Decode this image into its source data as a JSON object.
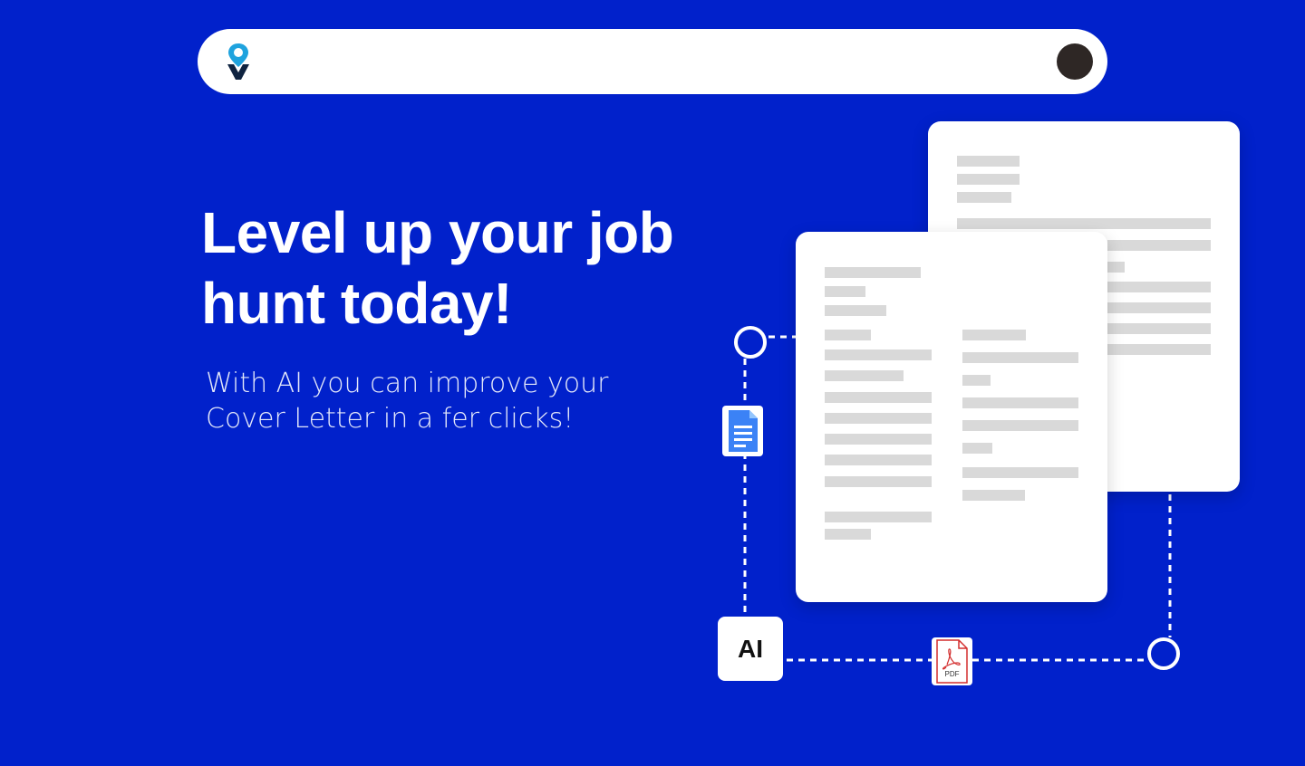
{
  "header": {
    "logo_icon": "map-pin-v-logo",
    "avatar_icon": "user-avatar-dark"
  },
  "hero": {
    "headline": "Level up your job hunt today!",
    "subline": "With AI you can improve your Cover Letter in a fer clicks!"
  },
  "illustration": {
    "ai_badge_label": "AI",
    "docs_icon": "google-docs-icon",
    "pdf_icon": "pdf-file-icon",
    "pdf_label": "PDF"
  },
  "colors": {
    "background": "#0121CB",
    "card": "#FFFFFF",
    "placeholder_line": "#D9D9D9",
    "avatar": "#2E2725",
    "docs_blue": "#3B82F6",
    "pdf_red": "#D32F2F"
  }
}
